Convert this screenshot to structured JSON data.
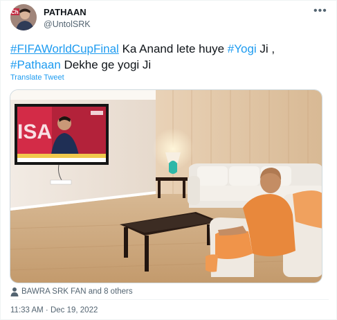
{
  "author": {
    "name": "PATHAAN",
    "handle": "@UntolSRK",
    "avatar_badge": "Ch"
  },
  "more_label": "•••",
  "tweet_text": {
    "line1": {
      "hashtag1": "#FIFAWorldCupFinal",
      "text1": " Ka Anand lete huye ",
      "hashtag2": "#Yogi",
      "text2": " Ji ,"
    },
    "line2": {
      "hashtag3": "#Pathaan",
      "text3": " Dekhe ge yogi Ji"
    }
  },
  "translate_label": "Translate Tweet",
  "media": {
    "tv_logo": "ISA"
  },
  "likes": {
    "text": "BAWRA SRK FAN and 8 others",
    "icon": "person-icon"
  },
  "timestamp": "11:33 AM · Dec 19, 2022",
  "colors": {
    "link": "#1d9bf0",
    "secondary": "#536471",
    "primary": "#0f1419"
  }
}
